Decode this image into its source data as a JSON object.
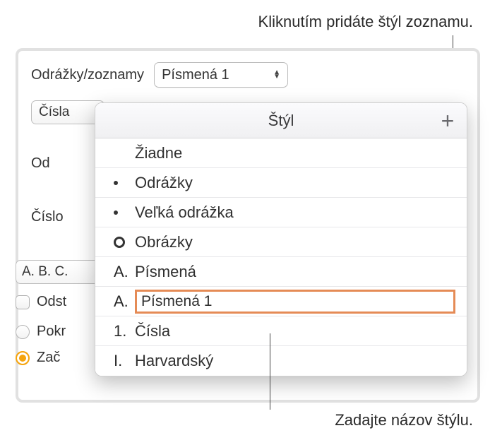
{
  "callouts": {
    "top": "Kliknutím pridáte štýl zoznamu.",
    "bottom": "Zadajte názov štýlu."
  },
  "sidebar": {
    "section_label": "Odrážky/zoznamy",
    "bullets_dd_value": "Písmená 1",
    "cisla_dd_value": "Čísla",
    "indent_label": "Od",
    "number_label": "Číslo",
    "abc_dd_value": "A. B. C.",
    "checkbox_label": "Odst",
    "radio_continue_label": "Pokr",
    "radio_start_label": "Zač"
  },
  "popover": {
    "title": "Štýl",
    "add_icon": "+",
    "styles": [
      {
        "marker": "",
        "label": "Žiadne"
      },
      {
        "marker": "dot",
        "label": "Odrážky"
      },
      {
        "marker": "dot",
        "label": "Veľká odrážka"
      },
      {
        "marker": "circle",
        "label": "Obrázky"
      },
      {
        "marker_text": "A.",
        "label": "Písmená"
      },
      {
        "marker_text": "A.",
        "label": "Písmená 1",
        "editing": true
      },
      {
        "marker_text": "1.",
        "label": "Čísla"
      },
      {
        "marker_text": "I.",
        "label": "Harvardský"
      }
    ]
  }
}
